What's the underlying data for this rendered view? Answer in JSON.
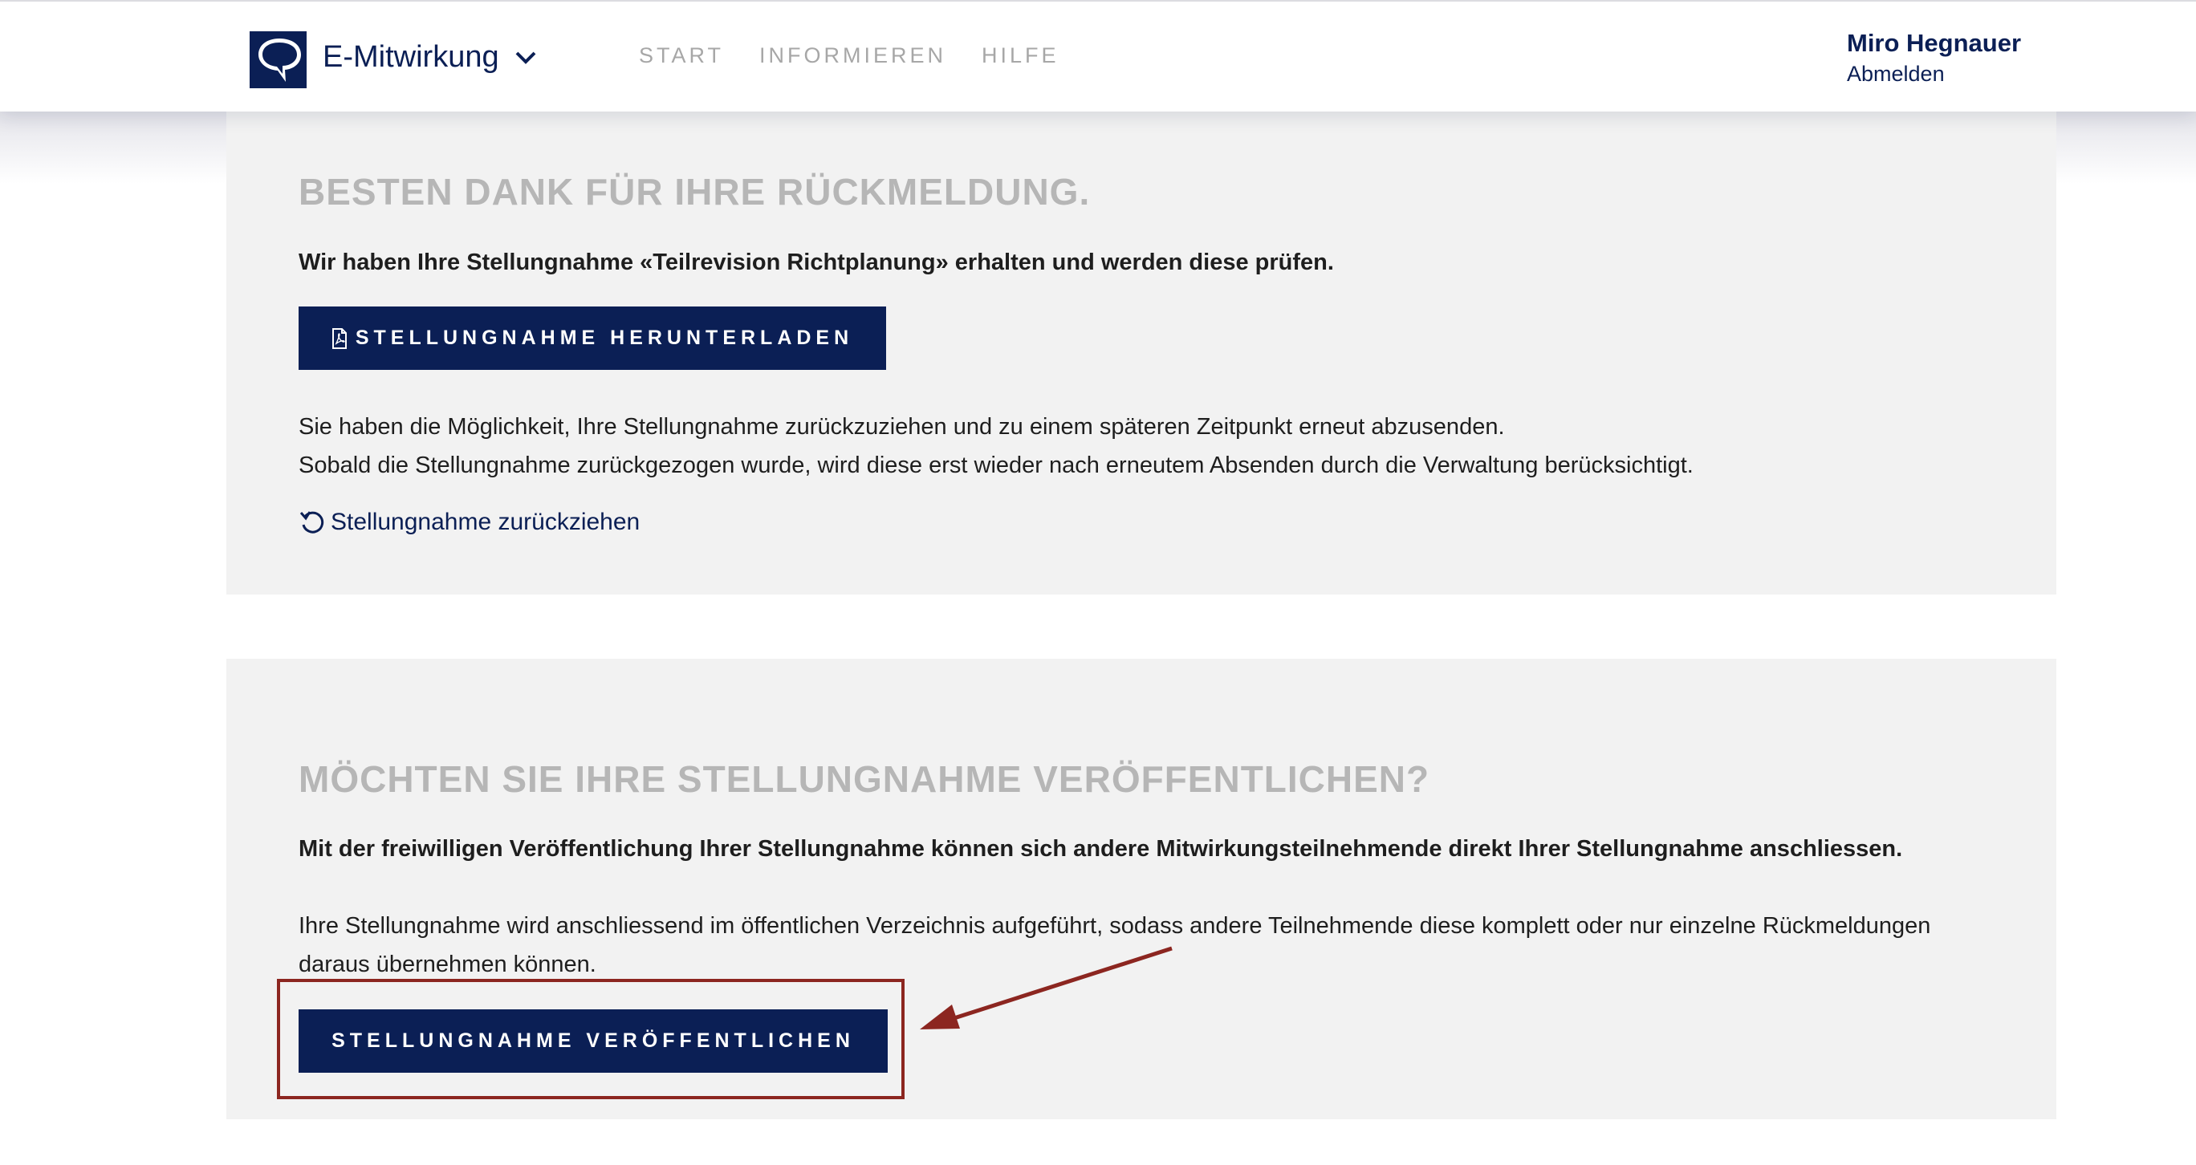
{
  "header": {
    "brand": "E-Mitwirkung",
    "nav": [
      "START",
      "INFORMIEREN",
      "HILFE"
    ],
    "user_name": "Miro Hegnauer",
    "logout": "Abmelden"
  },
  "feedback": {
    "title": "BESTEN DANK FÜR IHRE RÜCKMELDUNG.",
    "confirmation": "Wir haben Ihre Stellungnahme «Teilrevision Richtplanung» erhalten und werden diese prüfen.",
    "download_button": "STELLUNGNAHME HERUNTERLADEN",
    "info_line1": "Sie haben die Möglichkeit, Ihre Stellungnahme zurückzuziehen und zu einem späteren Zeitpunkt erneut abzusenden.",
    "info_line2": "Sobald die Stellungnahme zurückgezogen wurde, wird diese erst wieder nach erneutem Absenden durch die Verwaltung berücksichtigt.",
    "withdraw_link": "Stellungnahme zurückziehen"
  },
  "publish": {
    "title": "MÖCHTEN SIE IHRE STELLUNGNAHME VERÖFFENTLICHEN?",
    "bold_text": "Mit der freiwilligen Veröffentlichung Ihrer Stellungnahme können sich andere Mitwirkungsteilnehmende direkt Ihrer Stellungnahme anschliessen.",
    "text": "Ihre Stellungnahme wird anschliessend im öffentlichen Verzeichnis aufgeführt, sodass andere Teilnehmende diese komplett oder nur einzelne Rückmeldungen daraus übernehmen können.",
    "button": "STELLUNGNAHME VERÖFFENTLICHEN"
  },
  "colors": {
    "primary": "#0b1f55",
    "panel_bg": "#f2f2f2",
    "heading_grey": "#b6b6b6",
    "annotation_red": "#8c2620"
  },
  "icons": {
    "logo": "speech-bubble-logo-icon",
    "brand_menu": "chevron-down-icon",
    "download": "pdf-file-icon",
    "withdraw": "undo-arrow-icon"
  }
}
